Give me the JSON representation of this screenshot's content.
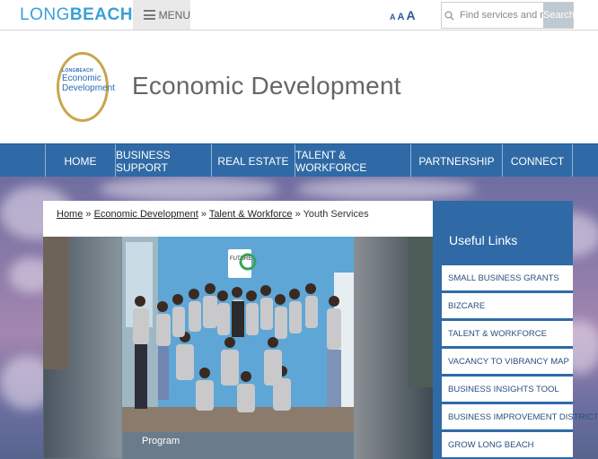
{
  "topbar": {
    "logo_long": "LONG",
    "logo_beach": "BEACH",
    "menu_label": "MENU",
    "textsize": [
      "A",
      "A",
      "A"
    ],
    "search_placeholder": "Find services and more",
    "search_button": "Search"
  },
  "header": {
    "seal_top": "LONGBEACH",
    "seal_line1": "Economic",
    "seal_line2": "Development",
    "title": "Economic Development"
  },
  "nav": {
    "items": [
      {
        "label": "HOME"
      },
      {
        "label": "BUSINESS SUPPORT"
      },
      {
        "label": "REAL ESTATE"
      },
      {
        "label": "TALENT & WORKFORCE"
      },
      {
        "label": "PARTNERSHIP"
      },
      {
        "label": "CONNECT"
      }
    ]
  },
  "breadcrumb": {
    "home": "Home",
    "sep": "»",
    "economic": "Economic Development",
    "talent": "Talent & Workforce",
    "current": "Youth Services"
  },
  "gallery": {
    "caption": "Program",
    "photo_sign": "FUTURE"
  },
  "sidebar": {
    "title": "Useful Links",
    "links": [
      {
        "label": "SMALL BUSINESS GRANTS"
      },
      {
        "label": "BIZCARE"
      },
      {
        "label": "TALENT & WORKFORCE"
      },
      {
        "label": "VACANCY TO VIBRANCY MAP"
      },
      {
        "label": "BUSINESS INSIGHTS TOOL"
      },
      {
        "label": "BUSINESS IMPROVEMENT DISTRICTS"
      },
      {
        "label": "GROW LONG BEACH"
      }
    ]
  },
  "colors": {
    "nav_blue": "#2f6aa6",
    "logo_blue": "#3aa0d8",
    "seal_gold": "#c8a54e"
  }
}
